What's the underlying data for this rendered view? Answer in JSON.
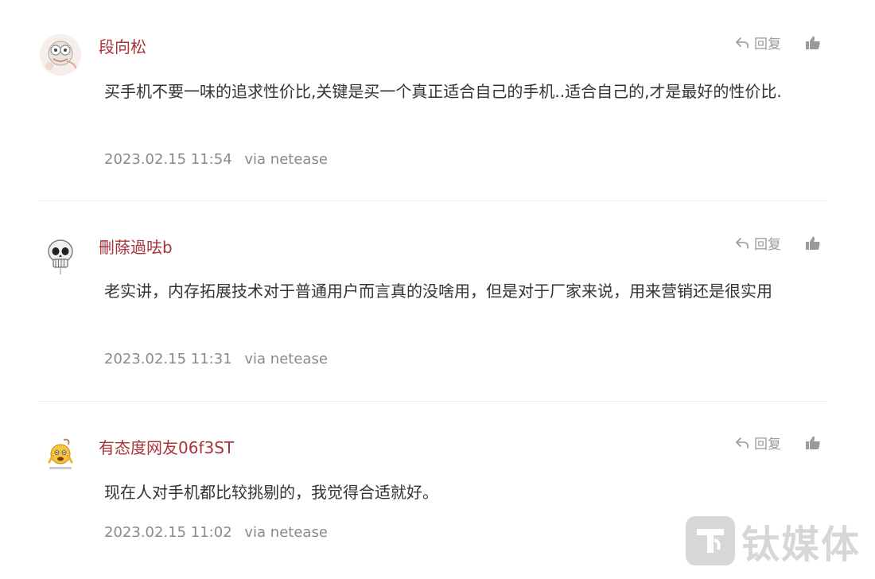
{
  "comments": [
    {
      "username": "段向松",
      "reply_label": "回复",
      "content": "买手机不要一味的追求性价比,关键是买一个真正适合自己的手机..适合自己的,才是最好的性价比.",
      "timestamp": "2023.02.15 11:54",
      "via": "via netease",
      "avatar_icon": "cartoon-avatar-icon"
    },
    {
      "username": "刪蒢過呿b",
      "reply_label": "回复",
      "content": "老实讲，内存拓展技术对于普通用户而言真的没啥用，但是对于厂家来说，用来营销还是很实用",
      "timestamp": "2023.02.15 11:31",
      "via": "via netease",
      "avatar_icon": "skull-avatar-icon"
    },
    {
      "username": "有态度网友06f3ST",
      "reply_label": "回复",
      "content": "现在人对手机都比较挑剔的，我觉得合适就好。",
      "timestamp": "2023.02.15 11:02",
      "via": "via netease",
      "avatar_icon": "emoji-avatar-icon"
    }
  ],
  "watermark": {
    "text": "钛媒体"
  },
  "colors": {
    "username": "#a8343a",
    "content": "#333333",
    "meta": "#8a8a8a",
    "icon": "#9a9a9a",
    "divider": "#ececec"
  }
}
